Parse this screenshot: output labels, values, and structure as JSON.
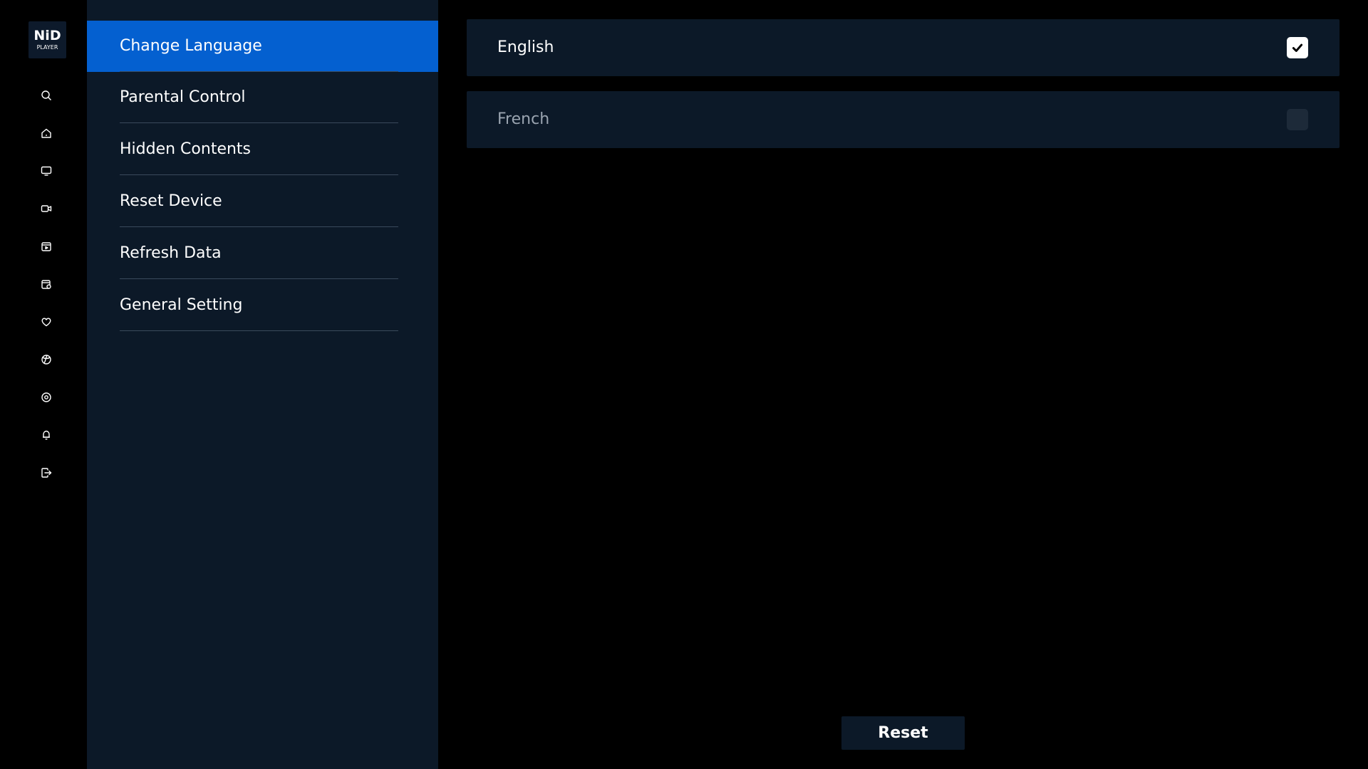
{
  "logo": {
    "mark": "NiD",
    "sub": "PLAYER"
  },
  "rail": {
    "icons": [
      "search-icon",
      "home-icon",
      "tv-icon",
      "video-camera-icon",
      "calendar-play-icon",
      "calendar-lock-icon",
      "heart-icon",
      "sports-ball-icon",
      "settings-icon",
      "bell-icon",
      "logout-icon"
    ]
  },
  "menu": {
    "items": [
      {
        "label": "Change Language",
        "active": true
      },
      {
        "label": "Parental Control",
        "active": false
      },
      {
        "label": "Hidden Contents",
        "active": false
      },
      {
        "label": "Reset Device",
        "active": false
      },
      {
        "label": "Refresh Data",
        "active": false
      },
      {
        "label": "General Setting",
        "active": false
      }
    ]
  },
  "languages": [
    {
      "label": "English",
      "selected": true
    },
    {
      "label": "French",
      "selected": false
    }
  ],
  "reset_label": "Reset",
  "colors": {
    "accent": "#0460d0",
    "panel": "#0c1928",
    "background": "#000000",
    "muted_text": "#9aa4b0"
  }
}
